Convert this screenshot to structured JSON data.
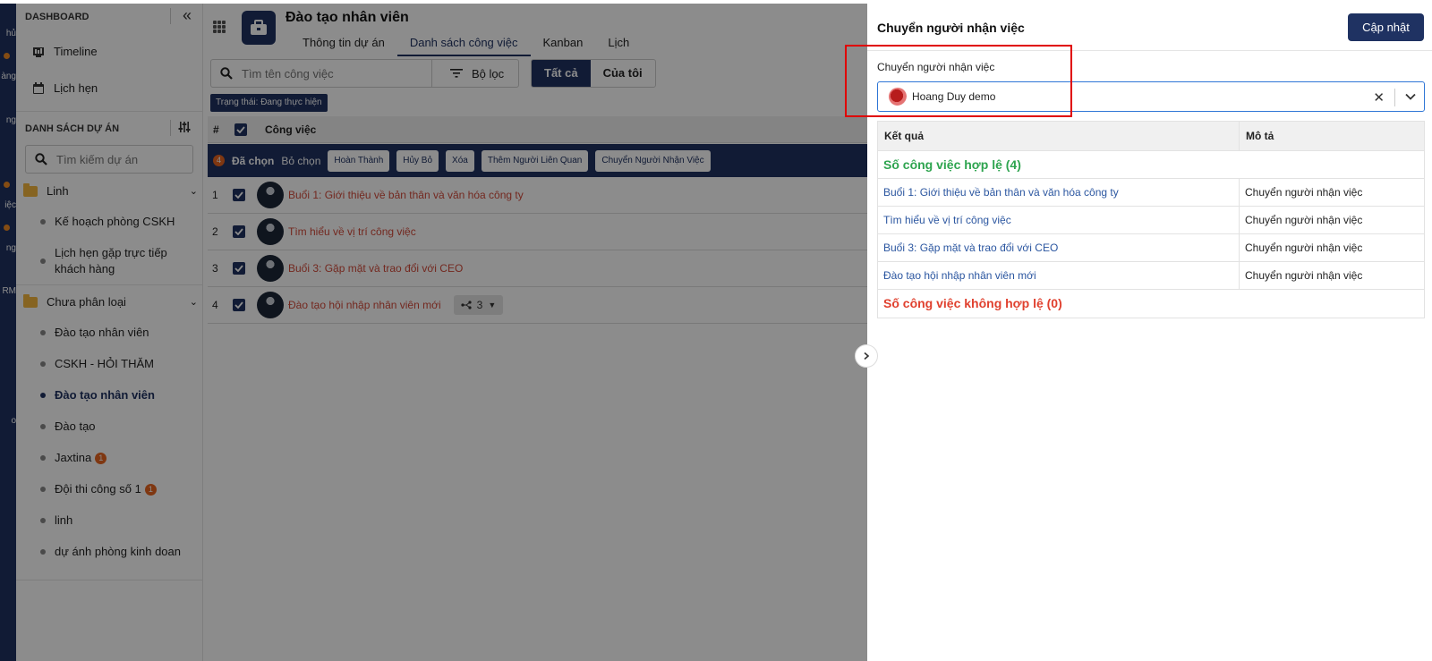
{
  "rail": {
    "items": [
      "hủ",
      "àng",
      "ng",
      "iệc",
      "ng",
      "RM",
      "o"
    ]
  },
  "sidebar": {
    "dashboard_title": "DASHBOARD",
    "nav": [
      {
        "label": "Timeline",
        "icon": "timeline-icon"
      },
      {
        "label": "Lịch hẹn",
        "icon": "calendar-icon"
      }
    ],
    "projects_title": "DANH SÁCH DỰ ÁN",
    "search_placeholder": "Tìm kiếm dự án",
    "groups": [
      {
        "label": "Linh",
        "items": [
          "Kế hoạch phòng CSKH",
          "Lịch hẹn gặp trực tiếp khách hàng"
        ]
      },
      {
        "label": "Chưa phân loại",
        "items": [
          "Đào tạo nhân viên",
          "CSKH - HỎI THĂM",
          "Đào tạo nhân viên",
          "Đào tạo",
          "Jaxtina",
          "Đội thi công số 1",
          "linh",
          "dự ánh phòng kinh doan"
        ]
      }
    ],
    "badges": {
      "jaxtina": "1",
      "doi_thi_cong": "1"
    }
  },
  "main": {
    "project_title": "Đào tạo nhân viên",
    "tabs": [
      "Thông tin dự án",
      "Danh sách công việc",
      "Kanban",
      "Lịch"
    ],
    "search_placeholder": "Tìm tên công việc",
    "filter_label": "Bộ lọc",
    "seg_all": "Tất cả",
    "seg_mine": "Của tôi",
    "status_chip": "Trạng thái: Đang thực hiện",
    "col_hash": "#",
    "col_task": "Công việc",
    "bulk": {
      "count": "4",
      "selected": "Đã chọn",
      "deselect": "Bỏ chọn",
      "actions": [
        "Hoàn Thành",
        "Hủy Bỏ",
        "Xóa",
        "Thêm Người Liên Quan",
        "Chuyển Người Nhận Việc"
      ]
    },
    "rows": [
      {
        "num": "1",
        "title": "Buổi 1: Giới thiệu về bản thân và văn hóa công ty"
      },
      {
        "num": "2",
        "title": "Tìm hiểu về vị trí công việc"
      },
      {
        "num": "3",
        "title": "Buổi 3: Gặp mặt và trao đổi với CEO"
      },
      {
        "num": "4",
        "title": "Đào tạo hội nhập nhân viên mới",
        "subtasks": "3"
      }
    ]
  },
  "drawer": {
    "title": "Chuyển người nhận việc",
    "update_button": "Cập nhật",
    "field_label": "Chuyển người nhận việc",
    "selected_user": "Hoang Duy demo",
    "table": {
      "col_result": "Kết quả",
      "col_desc": "Mô tả",
      "valid_group": "Số công việc hợp lệ (4)",
      "rows": [
        {
          "task": "Buổi 1: Giới thiệu về bản thân và văn hóa công ty",
          "desc": "Chuyển người nhận việc"
        },
        {
          "task": "Tìm hiểu về vị trí công việc",
          "desc": "Chuyển người nhận việc"
        },
        {
          "task": "Buổi 3: Gặp mặt và trao đổi với CEO",
          "desc": "Chuyển người nhận việc"
        },
        {
          "task": "Đào tạo hội nhập nhân viên mới",
          "desc": "Chuyển người nhận việc"
        }
      ],
      "invalid_group": "Số công việc không hợp lệ (0)"
    }
  },
  "colors": {
    "primary": "#1f3262",
    "accent_orange": "#e8651f",
    "success": "#2ea44f",
    "danger": "#e0402e",
    "highlight": "#e00000"
  }
}
